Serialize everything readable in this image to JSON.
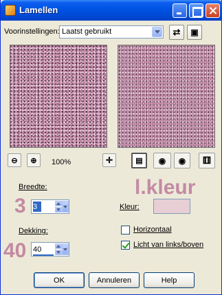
{
  "window": {
    "title": "Lamellen"
  },
  "presets": {
    "label": "Voorinstellingen:",
    "selected": "Laatst gebruikt"
  },
  "preview": {
    "zoom": "100%"
  },
  "width": {
    "label": "Breedte:",
    "value": "3",
    "overlay": "3"
  },
  "opacity": {
    "label": "Dekking:",
    "value": "40",
    "overlay": "40"
  },
  "color": {
    "overlay": "l.kleur",
    "label": "Kleur:",
    "value": "#e7cfd5"
  },
  "options": {
    "horizontal": {
      "label": "Horizontaal",
      "checked": false
    },
    "light": {
      "label": "Licht van links/boven",
      "checked": true
    }
  },
  "buttons": {
    "ok": "OK",
    "cancel": "Annuleren",
    "help": "Help"
  },
  "icons": [
    "app-icon",
    "minimize-icon",
    "maximize-icon",
    "close-icon",
    "reset-icon",
    "save-icon",
    "zoom-out-icon",
    "zoom-in-icon",
    "pan-icon",
    "proof-icon",
    "auto-proof-icon",
    "preview-icon",
    "randomize-icon"
  ]
}
